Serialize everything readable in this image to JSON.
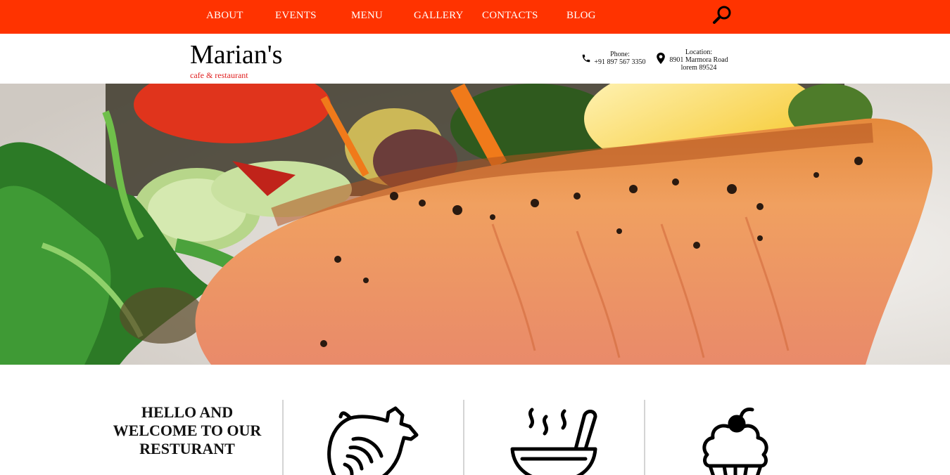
{
  "nav": {
    "items": [
      "ABOUT",
      "EVENTS",
      "MENU",
      "GALLERY",
      "CONTACTS",
      "BLOG"
    ]
  },
  "header": {
    "brand": "Marian's",
    "tagline": "cafe & restaurant",
    "phone_label": "Phone:",
    "phone_value": "+91 897 567 3350",
    "location_label": "Location:",
    "location_line1": "8901 Marmora Road",
    "location_line2": "lorem 89524"
  },
  "welcome": {
    "line1": "HELLO AND",
    "line2": "WELCOME TO OUR",
    "line3": "RESTURANT"
  },
  "icons": {
    "search": "search-icon",
    "phone": "phone-icon",
    "location": "location-pin-icon",
    "feature1": "chicken-icon",
    "feature2": "soup-bowl-icon",
    "feature3": "cupcake-icon"
  },
  "colors": {
    "accent": "#ff3300",
    "tagline": "#e02020"
  }
}
